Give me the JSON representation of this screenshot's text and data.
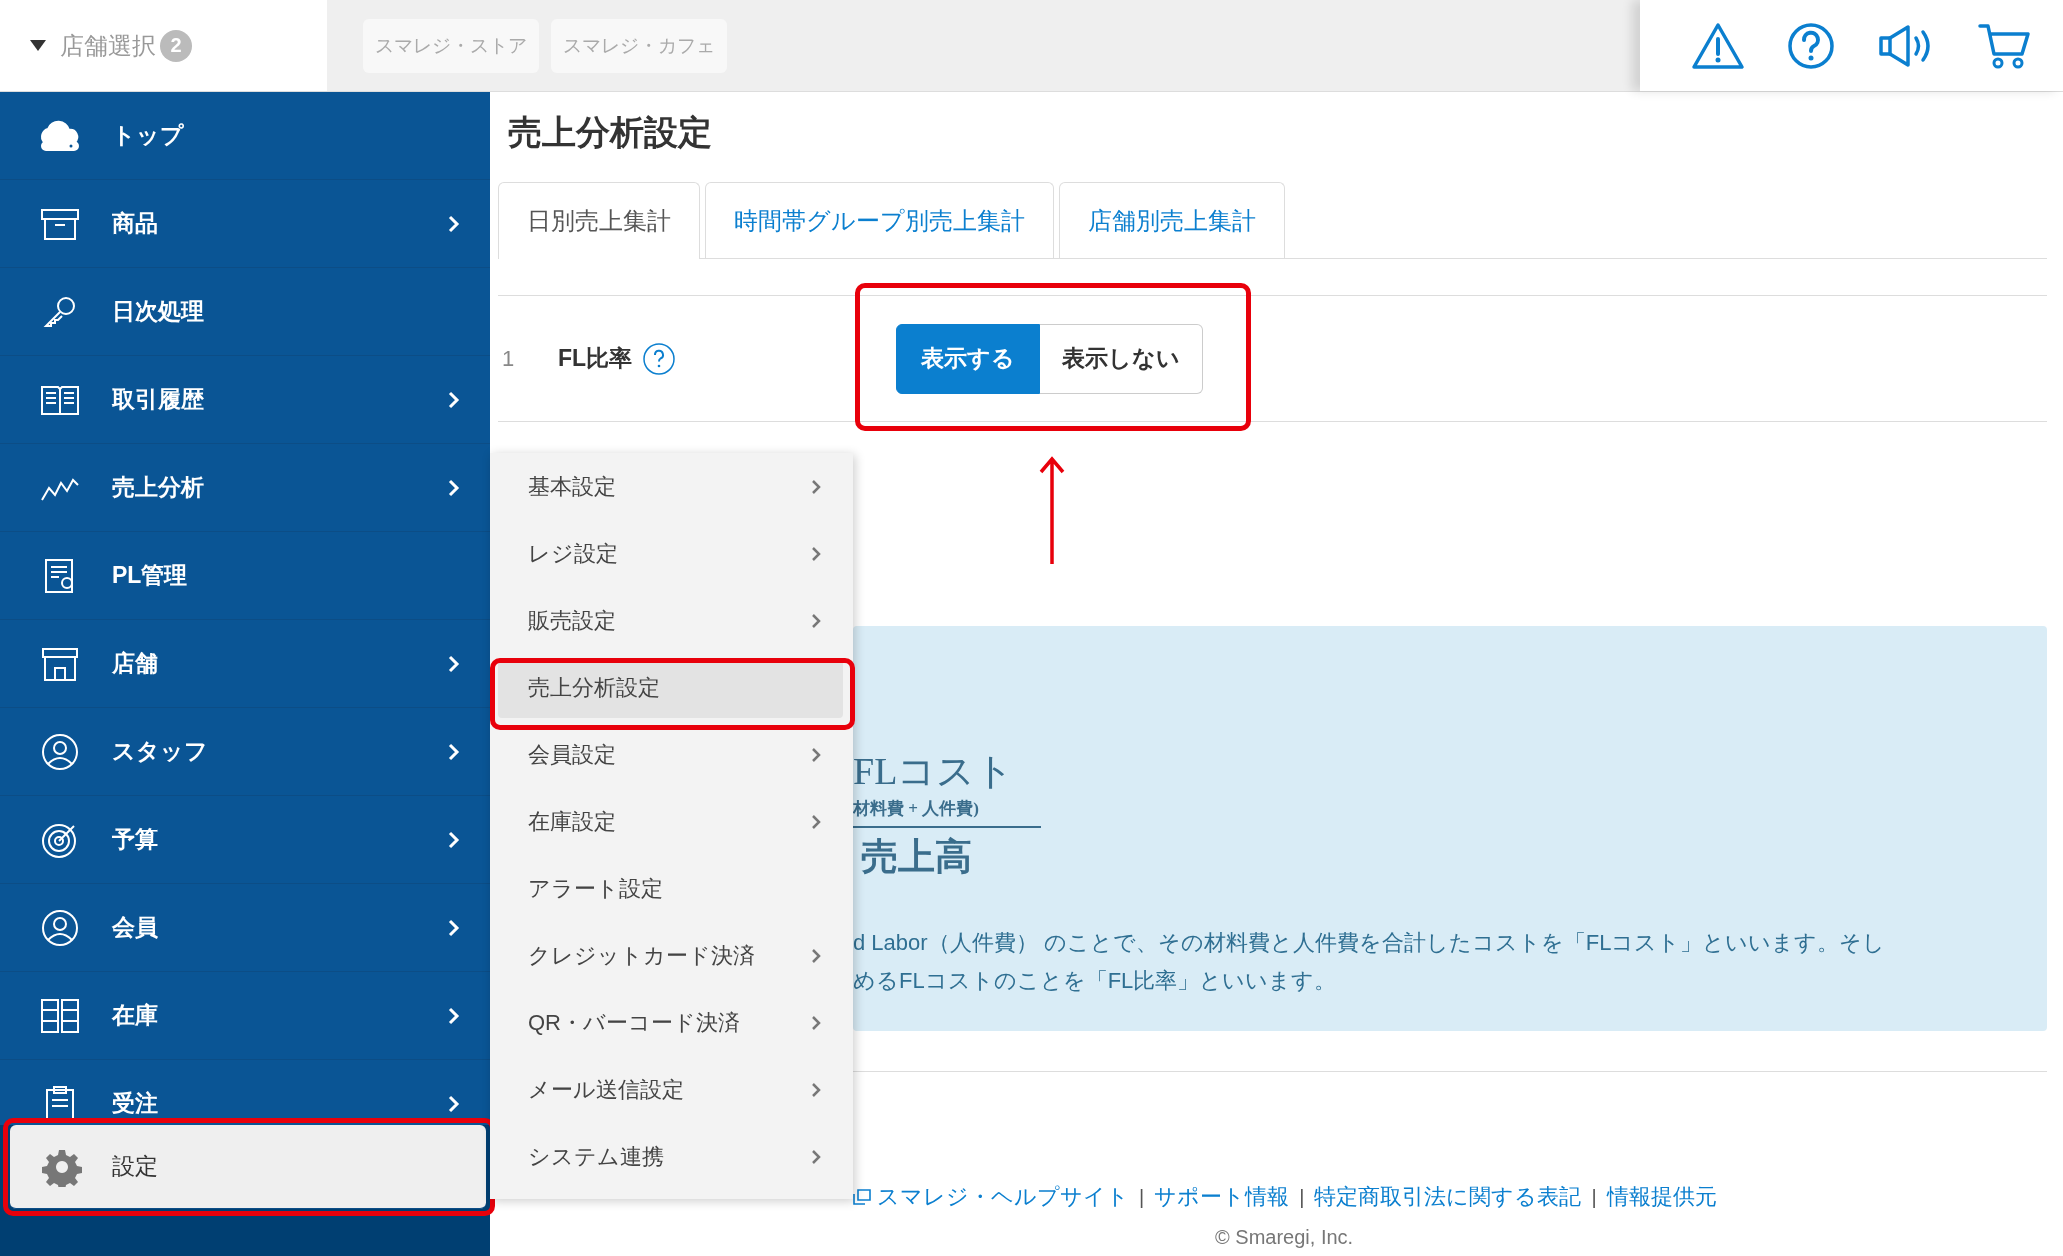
{
  "store_selector": {
    "label": "店舗選択",
    "count": "2",
    "expanded": true
  },
  "store_chips": [
    "スマレジ・ストア",
    "スマレジ・カフェ"
  ],
  "sidebar": {
    "items": [
      {
        "label": "トップ",
        "has_submenu": false,
        "selected": false
      },
      {
        "label": "商品",
        "has_submenu": true,
        "selected": false
      },
      {
        "label": "日次処理",
        "has_submenu": false,
        "selected": false
      },
      {
        "label": "取引履歴",
        "has_submenu": true,
        "selected": false
      },
      {
        "label": "売上分析",
        "has_submenu": true,
        "selected": false
      },
      {
        "label": "PL管理",
        "has_submenu": false,
        "selected": false
      },
      {
        "label": "店舗",
        "has_submenu": true,
        "selected": false
      },
      {
        "label": "スタッフ",
        "has_submenu": true,
        "selected": false
      },
      {
        "label": "予算",
        "has_submenu": true,
        "selected": false
      },
      {
        "label": "会員",
        "has_submenu": true,
        "selected": false
      },
      {
        "label": "在庫",
        "has_submenu": true,
        "selected": false
      },
      {
        "label": "受注",
        "has_submenu": true,
        "selected": false
      },
      {
        "label": "設定",
        "has_submenu": false,
        "selected": true
      }
    ]
  },
  "page_title": "売上分析設定",
  "tabs": [
    {
      "label": "日別売上集計",
      "selected": true
    },
    {
      "label": "時間帯グループ別売上集計",
      "selected": false
    },
    {
      "label": "店舗別売上集計",
      "selected": false
    }
  ],
  "settings_rows": [
    {
      "number": "1",
      "label": "FL比率",
      "options": [
        {
          "label": "表示する",
          "selected": true
        },
        {
          "label": "表示しない",
          "selected": false
        }
      ]
    }
  ],
  "settings_menu": {
    "items": [
      {
        "label": "基本設定",
        "has_submenu": true,
        "selected": false
      },
      {
        "label": "レジ設定",
        "has_submenu": true,
        "selected": false
      },
      {
        "label": "販売設定",
        "has_submenu": true,
        "selected": false
      },
      {
        "label": "売上分析設定",
        "has_submenu": false,
        "selected": true
      },
      {
        "label": "会員設定",
        "has_submenu": true,
        "selected": false
      },
      {
        "label": "在庫設定",
        "has_submenu": true,
        "selected": false
      },
      {
        "label": "アラート設定",
        "has_submenu": false,
        "selected": false
      },
      {
        "label": "クレジットカード決済",
        "has_submenu": true,
        "selected": false
      },
      {
        "label": "QR・バーコード決済",
        "has_submenu": true,
        "selected": false
      },
      {
        "label": "メール送信設定",
        "has_submenu": true,
        "selected": false
      },
      {
        "label": "システム連携",
        "has_submenu": true,
        "selected": false
      }
    ]
  },
  "info": {
    "formula_numerator": "FLコスト",
    "formula_note": "材料費 + 人件費)",
    "formula_denominator": "売上高",
    "text_lines": [
      "d Labor（人件費） のことで、その材料費と人件費を合計したコストを「FLコスト」といいます。そし",
      "めるFLコストのことを「FL比率」といいます。"
    ]
  },
  "footer": {
    "items": [
      {
        "kind": "link",
        "label": "スマレジ・ヘルプサイト",
        "icon": true
      },
      {
        "kind": "separator",
        "label": "|"
      },
      {
        "kind": "link",
        "label": "サポート情報",
        "icon": false
      },
      {
        "kind": "separator",
        "label": "|"
      },
      {
        "kind": "link",
        "label": "特定商取引法に関する表記",
        "icon": false
      },
      {
        "kind": "separator",
        "label": "|"
      },
      {
        "kind": "link",
        "label": "情報提供元",
        "icon": false
      }
    ],
    "copyright": "© Smaregi, Inc."
  }
}
